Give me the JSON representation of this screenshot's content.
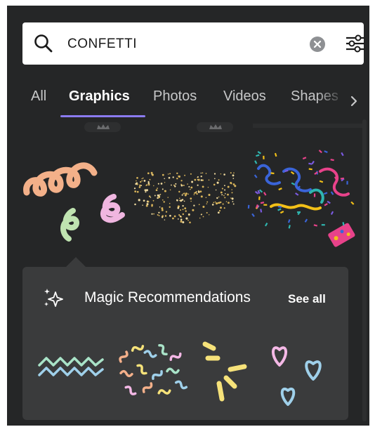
{
  "search": {
    "query": "CONFETTI",
    "icons": {
      "search": "search-icon",
      "clear": "clear-icon",
      "filter": "filter-sliders-icon"
    }
  },
  "tabs": [
    {
      "label": "All",
      "active": false
    },
    {
      "label": "Graphics",
      "active": true
    },
    {
      "label": "Photos",
      "active": false
    },
    {
      "label": "Videos",
      "active": false
    },
    {
      "label": "Shapes",
      "active": false
    }
  ],
  "tabs_more_icon": "chevron-right-icon",
  "results": [
    {
      "name": "pastel-swirls-graphic",
      "premium": false
    },
    {
      "name": "gold-glitter-graphic",
      "premium": false
    },
    {
      "name": "confetti-popper-graphic",
      "premium": false
    }
  ],
  "magic": {
    "title": "Magic Recommendations",
    "see_all": "See all",
    "icon": "sparkle-icon",
    "items": [
      "zigzag-lines-graphic",
      "pastel-squiggles-graphic",
      "yellow-burst-graphic",
      "hearts-graphic"
    ]
  },
  "colors": {
    "panel": "#252627",
    "accent": "#8b7bf0",
    "magic_bg": "#3a3b3c"
  }
}
